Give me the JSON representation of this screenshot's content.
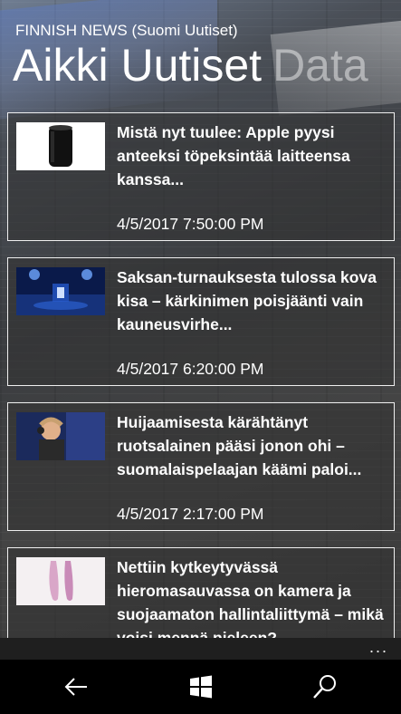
{
  "header": {
    "app_subtitle": "FINNISH NEWS (Suomi Uutiset)",
    "pivot_items": [
      "Aikki Uutiset",
      "Data"
    ]
  },
  "articles": [
    {
      "title": "Mistä nyt tuulee: Apple pyysi anteeksi töpeksintää laitteensa kanssa...",
      "date": "4/5/2017 7:50:00 PM",
      "thumbnail": "black-cylinder-computer-image"
    },
    {
      "title": "Saksan-turnauksesta tulossa kova kisa – kärkinimen poisjäänti vain kauneusvirhe...",
      "date": "4/5/2017 6:20:00 PM",
      "thumbnail": "esports-arena-stage-image"
    },
    {
      "title": "Huijaamisesta kärähtänyt ruotsalainen pääsi jonon ohi – suomalaispelaajan käämi paloi...",
      "date": "4/5/2017 2:17:00 PM",
      "thumbnail": "gamer-with-headset-image"
    },
    {
      "title": "Nettiin kytkeytyvässä hieromasauvassa on kamera ja suojaamaton hallintaliittymä – mikä voisi mennä pieleen?",
      "date": "",
      "thumbnail": "pink-devices-image"
    }
  ],
  "appbar": {
    "more_label": "..."
  },
  "navbar": {
    "back_icon": "back-arrow-icon",
    "home_icon": "windows-logo-icon",
    "search_icon": "search-icon"
  },
  "colors": {
    "card_border": "#ffffff",
    "appbar_bg": "#1f1f1f",
    "navbar_bg": "#000000"
  }
}
